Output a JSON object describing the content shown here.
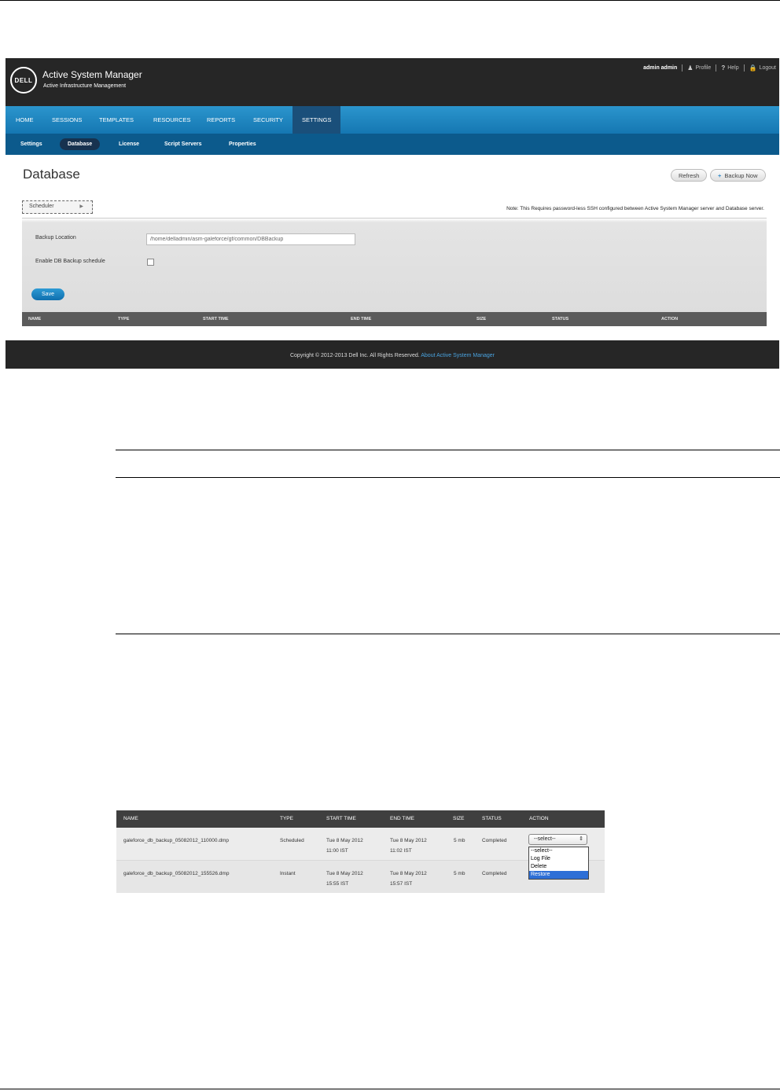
{
  "app": {
    "logo": "DELL",
    "title": "Active System Manager",
    "subtitle": "Active Infrastructure Management"
  },
  "user_menu": {
    "username": "admin admin",
    "profile": "Profile",
    "help": "Help",
    "logout": "Logout"
  },
  "nav": {
    "items": [
      "HOME",
      "SESSIONS",
      "TEMPLATES",
      "RESOURCES",
      "REPORTS",
      "SECURITY",
      "SETTINGS"
    ],
    "active": "SETTINGS"
  },
  "subnav": {
    "items": [
      "Settings",
      "Database",
      "License",
      "Script Servers",
      "Properties"
    ],
    "active": "Database"
  },
  "page": {
    "title": "Database",
    "refresh_label": "Refresh",
    "backup_now_label": "Backup Now",
    "scheduler_label": "Scheduler",
    "note": "Note: This Requires password-less SSH configured between Active System Manager server and Database server."
  },
  "form": {
    "backup_location_label": "Backup Location",
    "backup_location_value": "/home/delladmin/asm-galeforce/gf/common/DBBackup",
    "enable_schedule_label": "Enable DB Backup schedule",
    "enable_schedule_checked": false,
    "save_label": "Save"
  },
  "table": {
    "columns": [
      "NAME",
      "TYPE",
      "START TIME",
      "END TIME",
      "SIZE",
      "STATUS",
      "ACTION"
    ]
  },
  "footer": {
    "copyright": "Copyright © 2012-2013 Dell Inc. All Rights Reserved.",
    "about_link": "About Active System Manager"
  },
  "backup_table": {
    "columns": [
      "NAME",
      "TYPE",
      "START TIME",
      "END TIME",
      "SIZE",
      "STATUS",
      "ACTION"
    ],
    "rows": [
      {
        "name": "galeforce_db_backup_05082012_110000.dmp",
        "type": "Scheduled",
        "start_line1": "Tue 8 May 2012",
        "start_line2": "11:00 IST",
        "end_line1": "Tue 8 May 2012",
        "end_line2": "11:02 IST",
        "size": "5 mb",
        "status": "Completed",
        "action": "--select--"
      },
      {
        "name": "galeforce_db_backup_05082012_155526.dmp",
        "type": "Instant",
        "start_line1": "Tue 8 May 2012",
        "start_line2": "15:55 IST",
        "end_line1": "Tue 8 May 2012",
        "end_line2": "15:57 IST",
        "size": "5 mb",
        "status": "Completed",
        "action": ""
      }
    ],
    "dropdown_options": [
      "--select--",
      "Log File",
      "Delete",
      "Restore"
    ],
    "dropdown_highlighted": "Restore"
  },
  "colors": {
    "header_bg": "#262626",
    "nav_blue": "#1f86c0",
    "subnav_blue": "#0c5a8c",
    "link_blue": "#4aa3df"
  }
}
